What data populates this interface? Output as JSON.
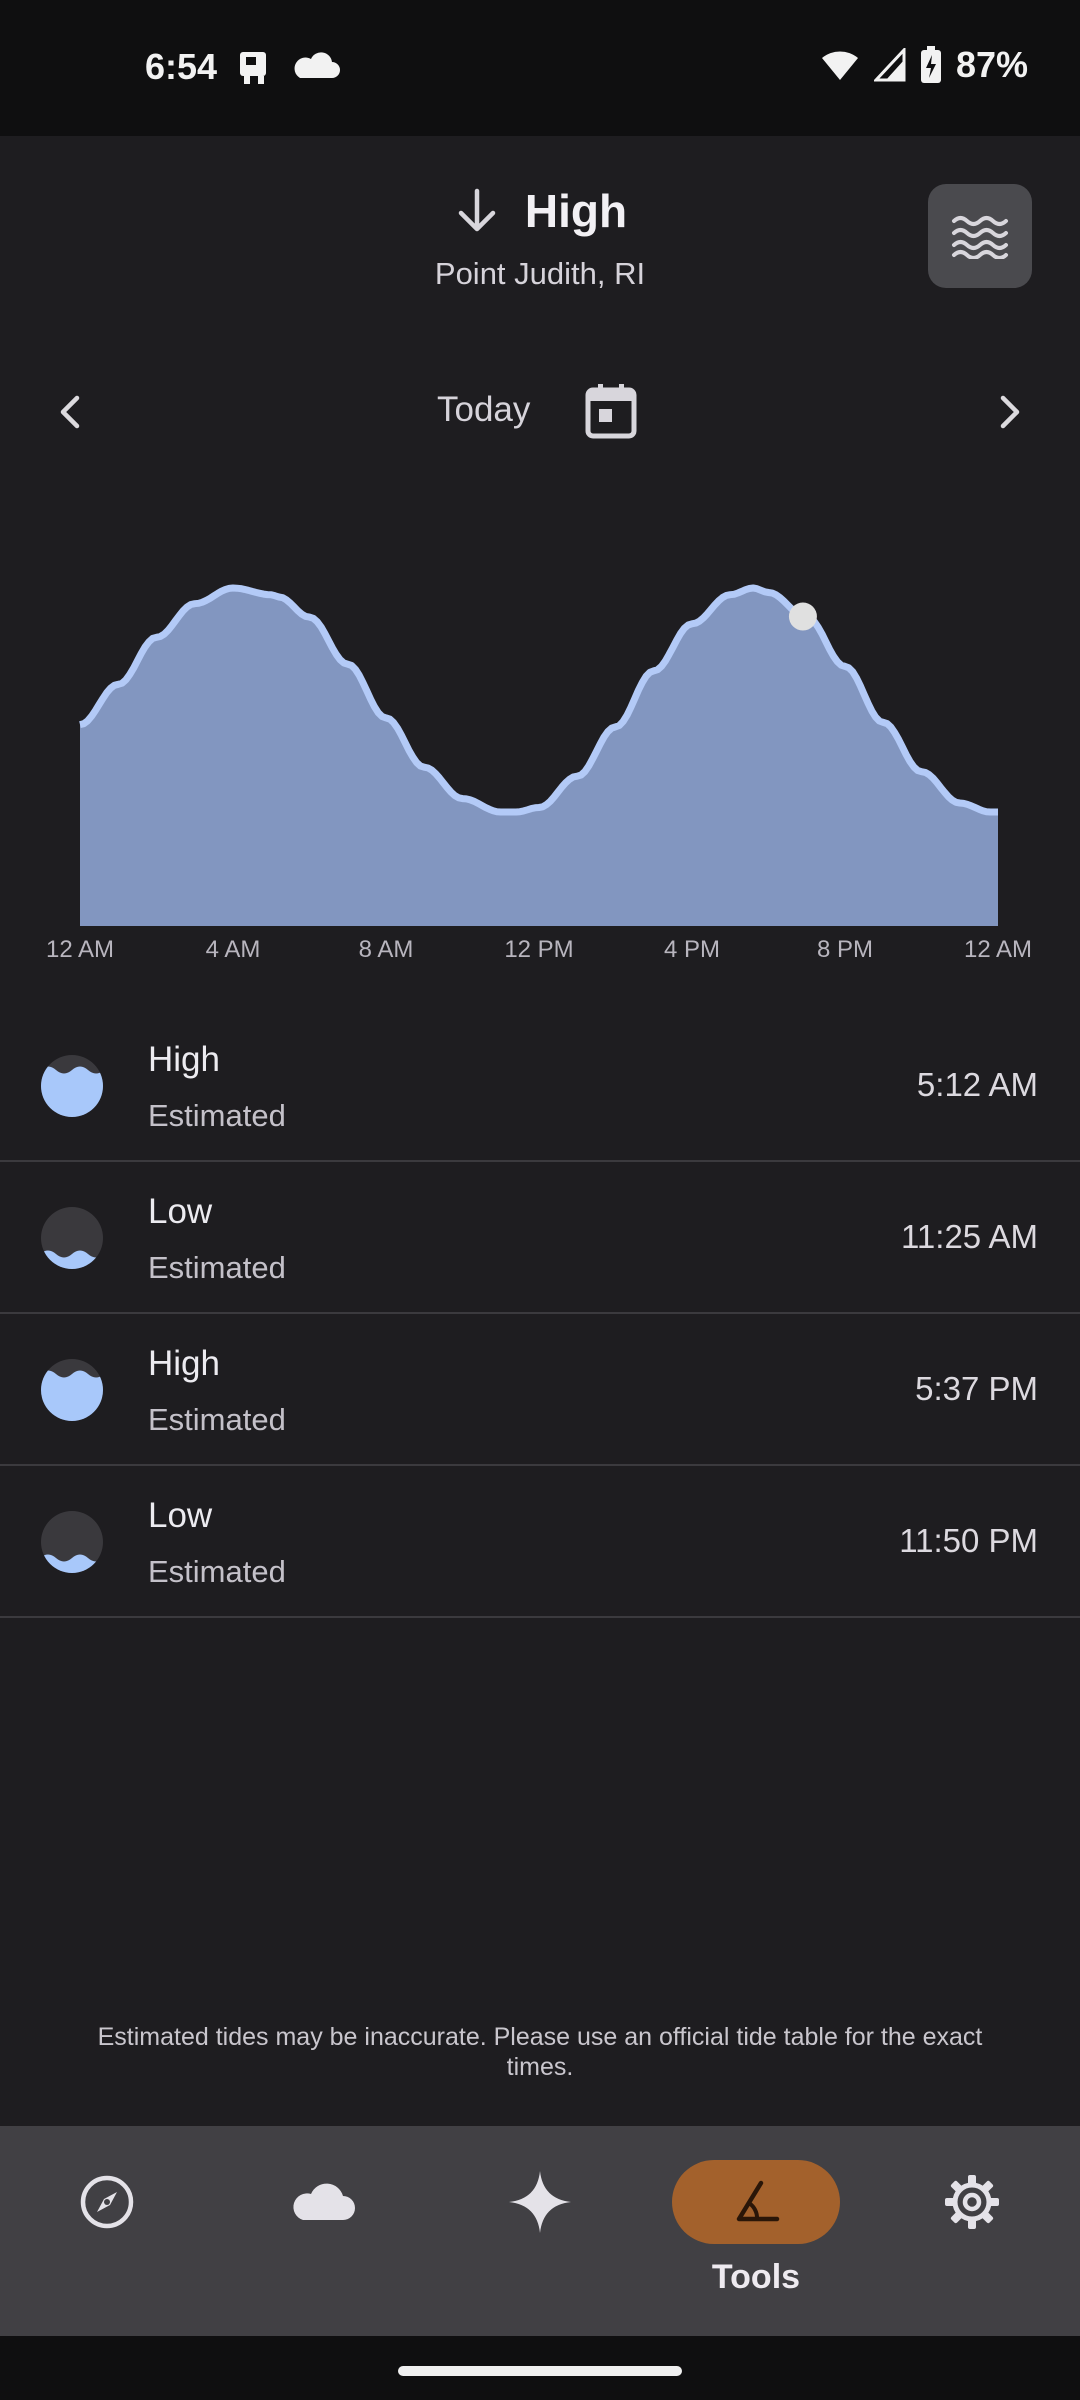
{
  "status_bar": {
    "time": "6:54",
    "battery": "87%"
  },
  "header": {
    "title": "High",
    "subtitle": "Point Judith, RI",
    "tide_button_icon": "waves-icon",
    "direction_icon": "arrow-down-icon"
  },
  "date_nav": {
    "label": "Today",
    "prev_icon": "chevron-left-icon",
    "next_icon": "chevron-right-icon",
    "calendar_icon": "calendar-icon"
  },
  "chart_data": {
    "type": "area",
    "x_tick_labels": [
      "12 AM",
      "4 AM",
      "8 AM",
      "12 PM",
      "4 PM",
      "8 PM",
      "12 AM"
    ],
    "x_hours": [
      0,
      1,
      2,
      3,
      4,
      5,
      5.2,
      6,
      7,
      8,
      9,
      10,
      11,
      11.4,
      12,
      13,
      14,
      15,
      16,
      17,
      17.6,
      18,
      19,
      20,
      21,
      22,
      23,
      23.8,
      24
    ],
    "y_relative": [
      0.39,
      0.57,
      0.78,
      0.93,
      1.0,
      0.97,
      0.96,
      0.87,
      0.66,
      0.42,
      0.2,
      0.06,
      0.0,
      0.0,
      0.02,
      0.16,
      0.38,
      0.63,
      0.84,
      0.97,
      1.0,
      0.98,
      0.87,
      0.65,
      0.4,
      0.18,
      0.04,
      0.0,
      0.0
    ],
    "xlim": [
      0,
      24
    ],
    "ylim": [
      0,
      1
    ],
    "current_hour": 18.9,
    "colors": {
      "fill": "#8296c0",
      "line": "#b3caf7",
      "marker": "#e0e0e0"
    }
  },
  "tides": [
    {
      "type": "High",
      "note": "Estimated",
      "time": "5:12 AM",
      "kind": "high"
    },
    {
      "type": "Low",
      "note": "Estimated",
      "time": "11:25 AM",
      "kind": "low"
    },
    {
      "type": "High",
      "note": "Estimated",
      "time": "5:37 PM",
      "kind": "high"
    },
    {
      "type": "Low",
      "note": "Estimated",
      "time": "11:50 PM",
      "kind": "low"
    }
  ],
  "disclaimer": "Estimated tides may be inaccurate. Please use an official tide table for the exact times.",
  "bottom_nav": {
    "items": [
      {
        "icon": "compass-icon",
        "label": ""
      },
      {
        "icon": "cloud-icon",
        "label": ""
      },
      {
        "icon": "sparkle-icon",
        "label": ""
      },
      {
        "icon": "angle-tool-icon",
        "label": "Tools",
        "active": true
      },
      {
        "icon": "gear-icon",
        "label": ""
      }
    ]
  },
  "colors": {
    "background": "#1e1d20",
    "accent_active": "#a3612c",
    "tide_blue": "#a8c8fa",
    "nav_bg": "#414044"
  }
}
